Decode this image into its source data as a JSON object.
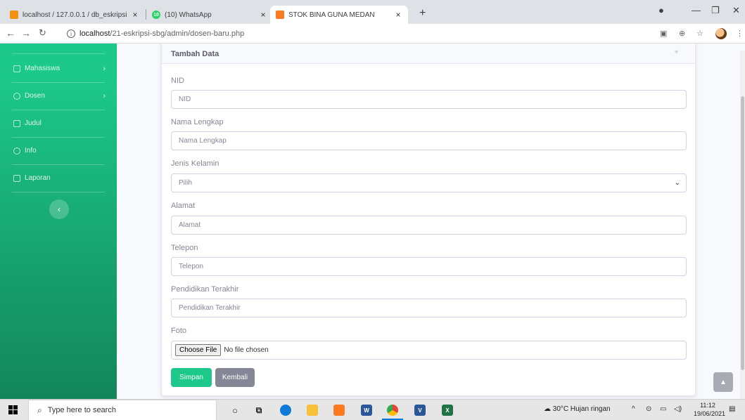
{
  "browser": {
    "tabs": [
      {
        "title": "localhost / 127.0.0.1 / db_eskripsi",
        "favicon": "phpmyadmin-icon",
        "active": false
      },
      {
        "title": "(10) WhatsApp",
        "favicon": "whatsapp-icon",
        "badge": "10",
        "active": false
      },
      {
        "title": "STOK BINA GUNA MEDAN",
        "favicon": "xampp-icon",
        "active": true
      }
    ],
    "new_tab": "+",
    "url_host": "localhost",
    "url_path": "/21-eskripsi-sbg/admin/dosen-baru.php"
  },
  "sidebar": {
    "items": [
      {
        "label": "Mahasiswa",
        "icon": "table-icon",
        "has_chevron": true
      },
      {
        "label": "Dosen",
        "icon": "user-icon",
        "has_chevron": true
      },
      {
        "label": "Judul",
        "icon": "table-icon",
        "has_chevron": false
      },
      {
        "label": "Info",
        "icon": "info-icon",
        "has_chevron": false
      },
      {
        "label": "Laporan",
        "icon": "print-icon",
        "has_chevron": false
      }
    ],
    "toggle": "‹"
  },
  "card": {
    "title": "Tambah Data",
    "fields": [
      {
        "label": "NID",
        "placeholder": "NID"
      },
      {
        "label": "Nama Lengkap",
        "placeholder": "Nama Lengkap"
      },
      {
        "label": "Jenis Kelamin",
        "selected": "Pilih"
      },
      {
        "label": "Alamat",
        "placeholder": "Alamat"
      },
      {
        "label": "Telepon",
        "placeholder": "Telepon"
      },
      {
        "label": "Pendidikan Terakhir",
        "placeholder": "Pendidikan Terakhir"
      },
      {
        "label": "Foto",
        "file_button": "Choose File",
        "file_status": "No file chosen"
      }
    ],
    "save_label": "Simpan",
    "back_label": "Kembali"
  },
  "taskbar": {
    "search_placeholder": "Type here to search",
    "weather": "30°C  Hujan ringan",
    "time": "11:12",
    "date": "19/06/2021"
  },
  "colors": {
    "primary_green": "#1cc88a",
    "secondary_gray": "#858796"
  }
}
